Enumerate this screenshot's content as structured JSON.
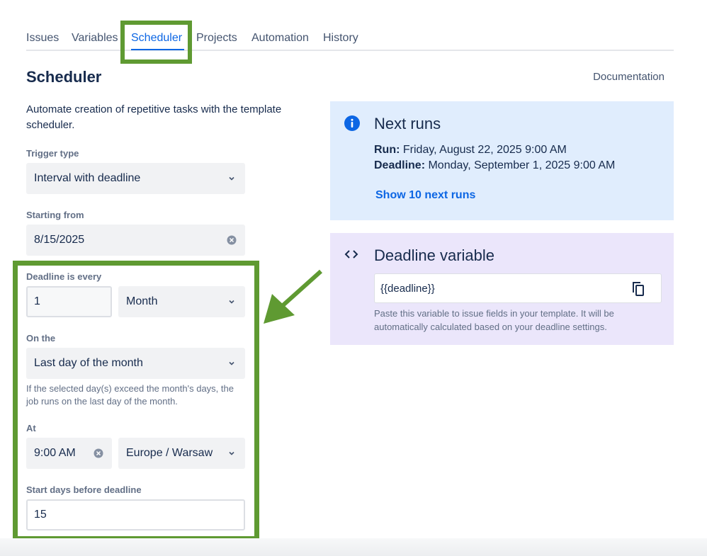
{
  "tabs": [
    {
      "label": "Issues"
    },
    {
      "label": "Variables"
    },
    {
      "label": "Scheduler",
      "active": true
    },
    {
      "label": "Projects"
    },
    {
      "label": "Automation"
    },
    {
      "label": "History"
    }
  ],
  "header": {
    "title": "Scheduler",
    "documentation_link": "Documentation"
  },
  "description": "Automate creation of repetitive tasks with the template scheduler.",
  "form": {
    "trigger_type": {
      "label": "Trigger type",
      "value": "Interval with deadline"
    },
    "starting_from": {
      "label": "Starting from",
      "value": "8/15/2025"
    },
    "deadline_every": {
      "label": "Deadline is every",
      "number": "1",
      "unit": "Month"
    },
    "on_the": {
      "label": "On the",
      "value": "Last day of the month",
      "hint": "If the selected day(s) exceed the month's days, the job runs on the last day of the month."
    },
    "at": {
      "label": "At",
      "time": "9:00 AM",
      "timezone": "Europe / Warsaw"
    },
    "start_days_before": {
      "label": "Start days before deadline",
      "value": "15"
    }
  },
  "next_runs": {
    "title": "Next runs",
    "run_label": "Run:",
    "run_value": "Friday, August 22, 2025 9:00 AM",
    "deadline_label": "Deadline:",
    "deadline_value": "Monday, September 1, 2025 9:00 AM",
    "show_more": "Show 10 next runs"
  },
  "deadline_variable": {
    "title": "Deadline variable",
    "value": "{{deadline}}",
    "help": "Paste this variable to issue fields in your template. It will be automatically calculated based on your deadline settings."
  },
  "colors": {
    "accent": "#0c66e4",
    "highlight": "#5f9a32",
    "runs_panel": "#e0edfd",
    "variable_panel": "#ebe6fb"
  },
  "icons": [
    "info-icon",
    "code-icon",
    "copy-icon",
    "chevron-down-icon",
    "clear-icon",
    "arrow-annotation"
  ]
}
